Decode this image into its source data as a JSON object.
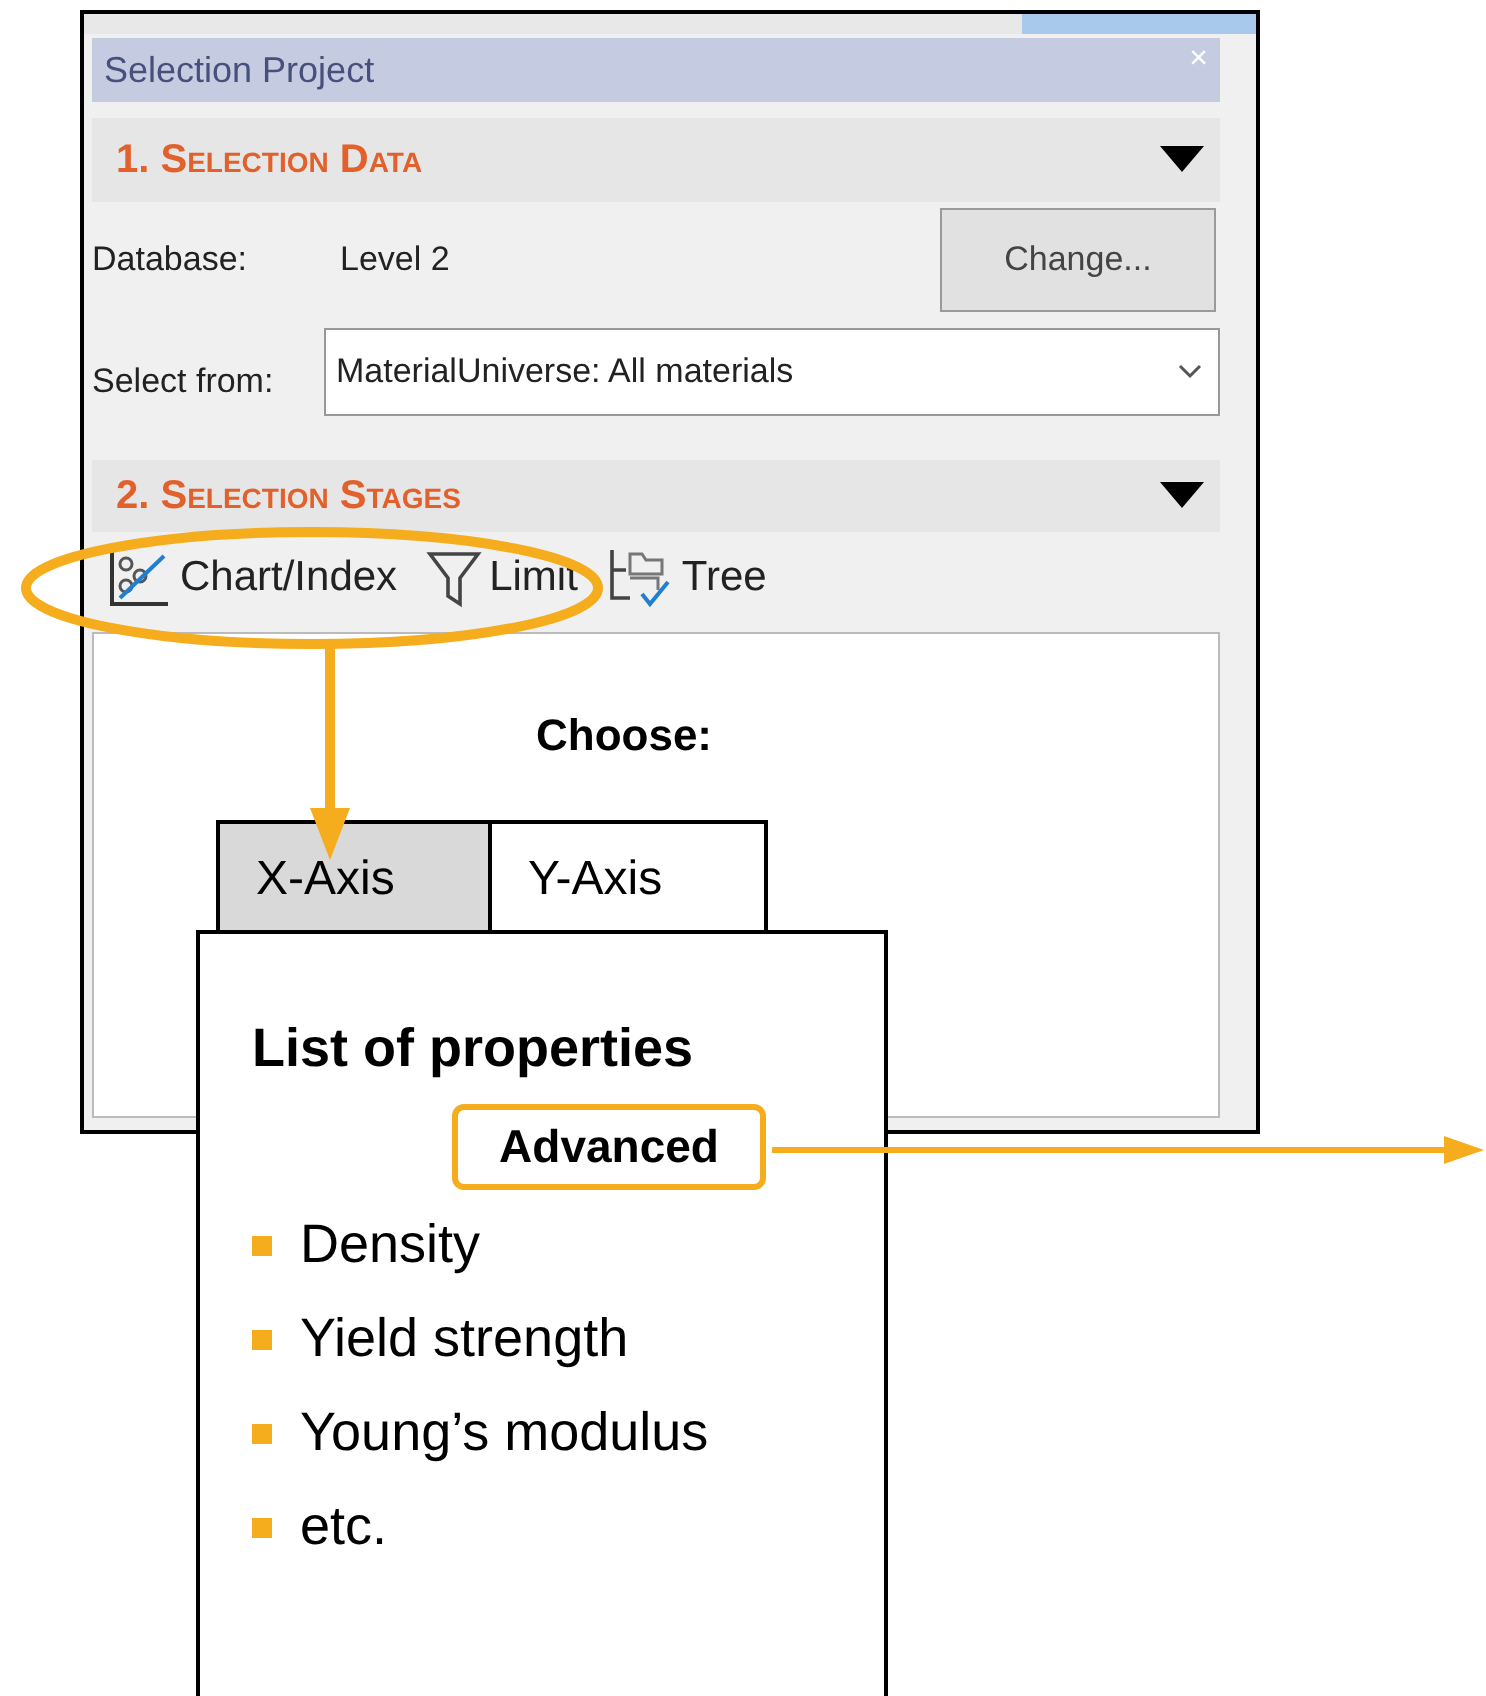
{
  "panel": {
    "title": "Selection Project",
    "close": "×",
    "sections": [
      {
        "heading": "1. Selection Data",
        "expanded": true
      },
      {
        "heading": "2. Selection Stages",
        "expanded": true
      }
    ],
    "database_label": "Database:",
    "database_value": "Level 2",
    "change_button": "Change...",
    "select_label": "Select from:",
    "select_value": "MaterialUniverse: All materials",
    "tools": [
      {
        "kind": "chart",
        "label": "Chart/Index"
      },
      {
        "kind": "limit",
        "label": "Limit"
      },
      {
        "kind": "tree",
        "label": "Tree"
      }
    ]
  },
  "callout": {
    "heading": "Choose:",
    "tabs": [
      {
        "label": "X-Axis",
        "selected": true
      },
      {
        "label": "Y-Axis",
        "selected": false
      }
    ],
    "title": "List of properties",
    "advanced": "Advanced",
    "items": [
      "Density",
      "Yield strength",
      "Young’s modulus",
      "etc."
    ]
  }
}
